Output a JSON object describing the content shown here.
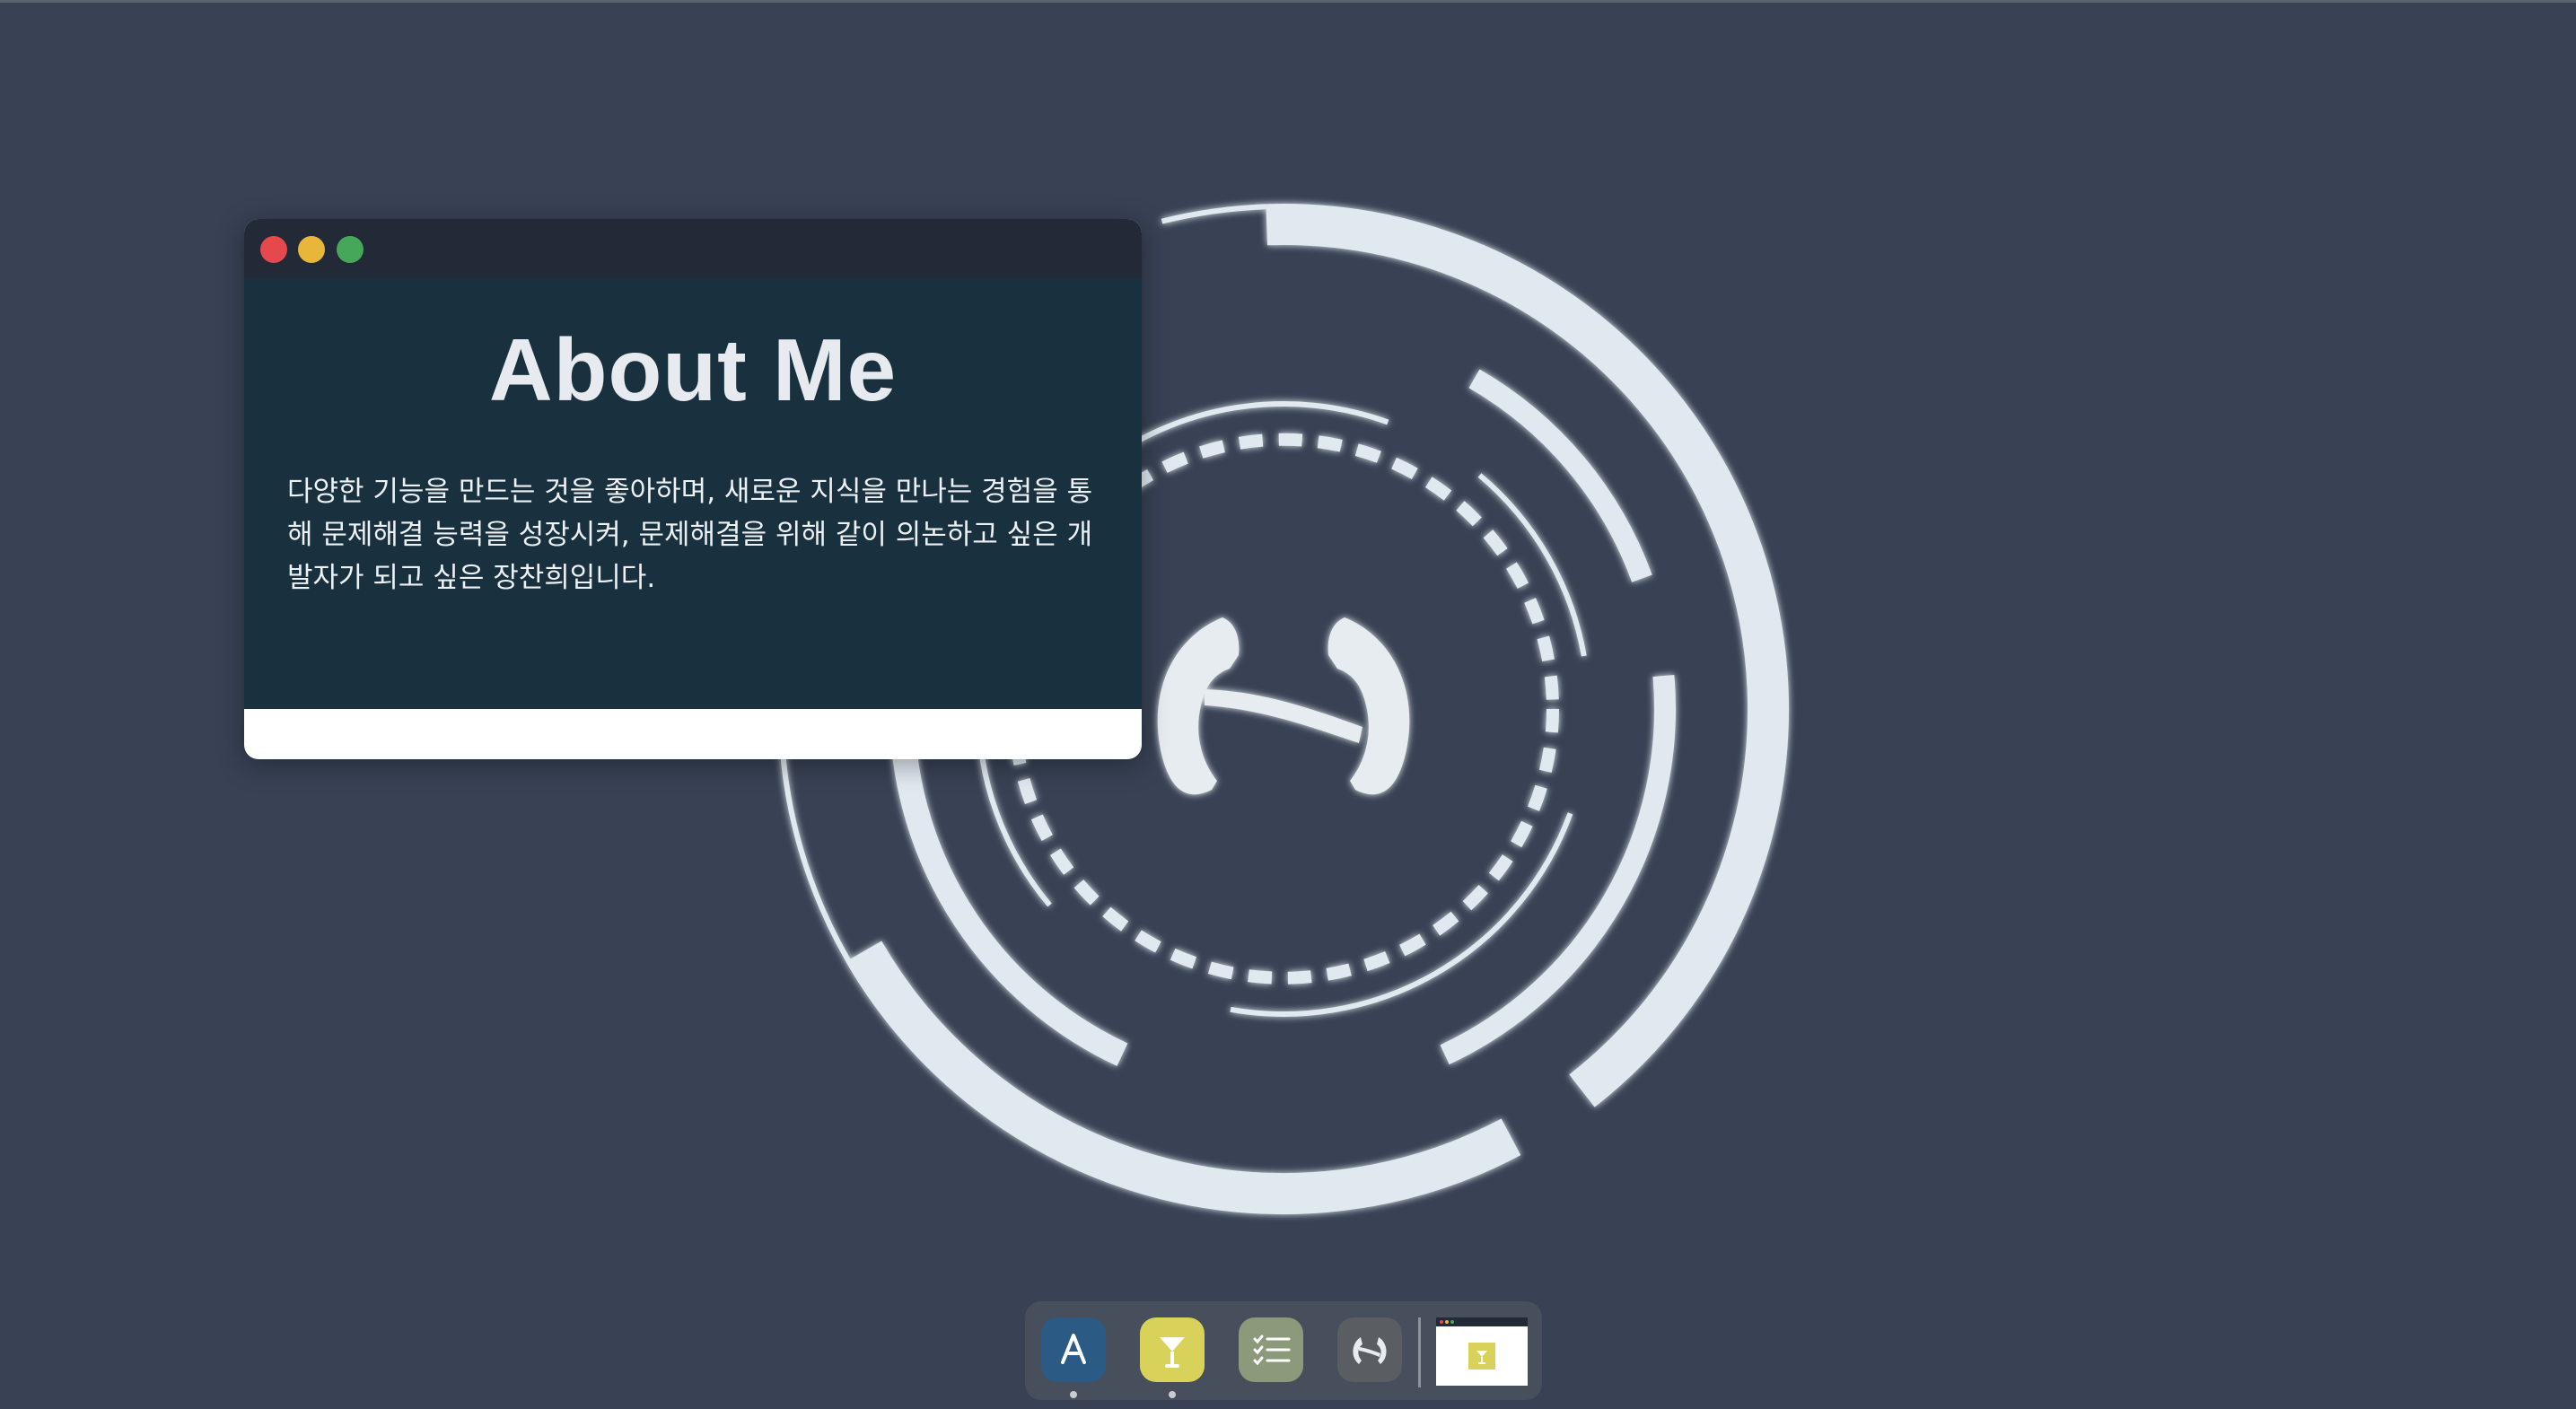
{
  "window": {
    "title": "About Me",
    "body": "다양한 기능을 만드는 것을 좋아하며, 새로운 지식을 만나는 경험을 통해 문제해결 능력을 성장시켜, 문제해결을 위해 같이 의논하고 싶은 개발자가 되고 싶은 장찬희입니다."
  },
  "dock": {
    "items": [
      {
        "name": "app-store-icon",
        "color": "#2b5a85",
        "running": true
      },
      {
        "name": "cocktail-icon",
        "color": "#d8d15a",
        "running": true
      },
      {
        "name": "checklist-icon",
        "color": "#8a9a7a",
        "running": false
      },
      {
        "name": "logo-icon",
        "color": "#5a5d62",
        "running": false
      }
    ]
  },
  "colors": {
    "background": "#384254",
    "window_content": "#19303f",
    "titlebar": "#222937",
    "emblem": "#dfe9ef"
  }
}
